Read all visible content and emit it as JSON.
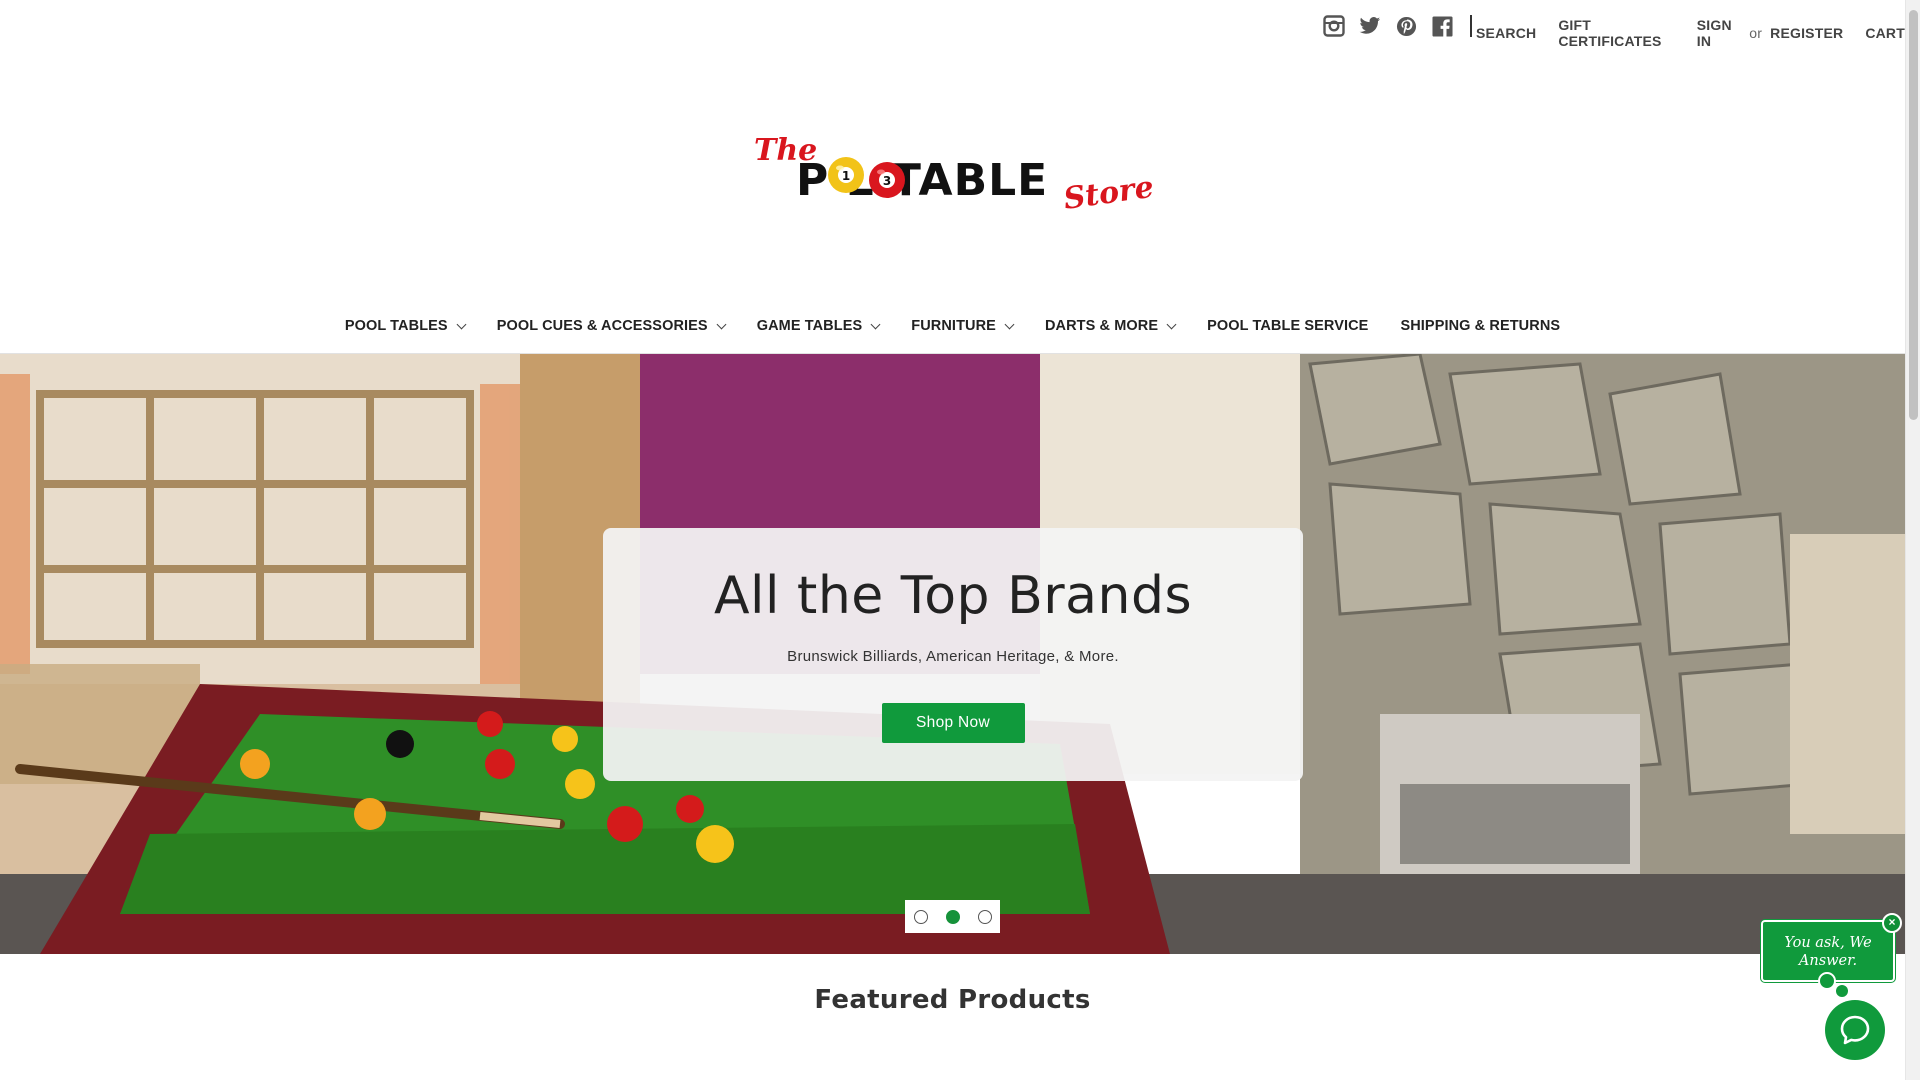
{
  "social": {
    "icons": [
      "instagram-icon",
      "twitter-icon",
      "pinterest-icon",
      "facebook-icon"
    ]
  },
  "utility": {
    "search": "SEARCH",
    "gift_certificates": "GIFT CERTIFICATES",
    "sign_in": "SIGN IN",
    "or": "or",
    "register": "REGISTER",
    "cart": "CART"
  },
  "logo": {
    "the": "The",
    "main": "P  L TABLE",
    "store": "Store",
    "ball1": "1",
    "ball2": "3"
  },
  "nav": {
    "items": [
      {
        "label": "POOL TABLES",
        "dropdown": true
      },
      {
        "label": "POOL CUES & ACCESSORIES",
        "dropdown": true
      },
      {
        "label": "GAME TABLES",
        "dropdown": true
      },
      {
        "label": "FURNITURE",
        "dropdown": true
      },
      {
        "label": "DARTS & MORE",
        "dropdown": true
      },
      {
        "label": "POOL TABLE SERVICE",
        "dropdown": false
      },
      {
        "label": "SHIPPING & RETURNS",
        "dropdown": false
      }
    ]
  },
  "hero": {
    "title": "All the Top Brands",
    "subtitle": "Brunswick Billiards, American Heritage, & More.",
    "button": "Shop Now",
    "slides": 3,
    "active_slide": 2
  },
  "featured": {
    "heading": "Featured Products"
  },
  "chat": {
    "bubble_text": "You ask, We Answer.",
    "close": "×"
  },
  "colors": {
    "accent_green": "#109a3c",
    "logo_red": "#d9161e",
    "ball_yellow": "#f2c318"
  }
}
